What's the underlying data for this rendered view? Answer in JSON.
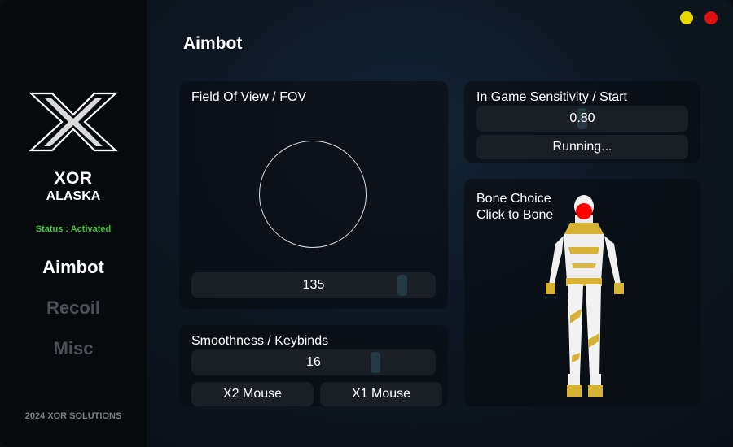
{
  "sidebar": {
    "brand_line1": "XOR",
    "brand_line2": "ALASKA",
    "status": "Status : Activated",
    "nav": [
      {
        "label": "Aimbot",
        "active": true
      },
      {
        "label": "Recoil",
        "active": false
      },
      {
        "label": "Misc",
        "active": false
      }
    ],
    "footer": "2024 XOR SOLUTIONS"
  },
  "window_controls": {
    "minimize_color": "#e8d800",
    "close_color": "#e01010"
  },
  "main": {
    "title": "Aimbot",
    "fov": {
      "title": "Field Of View / FOV",
      "value": "135"
    },
    "smoothness": {
      "title": "Smoothness / Keybinds",
      "value": "16",
      "key1": "X2 Mouse",
      "key2": "X1 Mouse"
    },
    "sensitivity": {
      "title": "In Game Sensitivity / Start",
      "value": "0.80",
      "status_button": "Running..."
    },
    "bone": {
      "title_line1": "Bone Choice",
      "title_line2": "Click to Bone"
    }
  },
  "colors": {
    "accent_green": "#3fc63a",
    "bone_marker": "#ff0000",
    "outfit_gold": "#d8b233"
  }
}
